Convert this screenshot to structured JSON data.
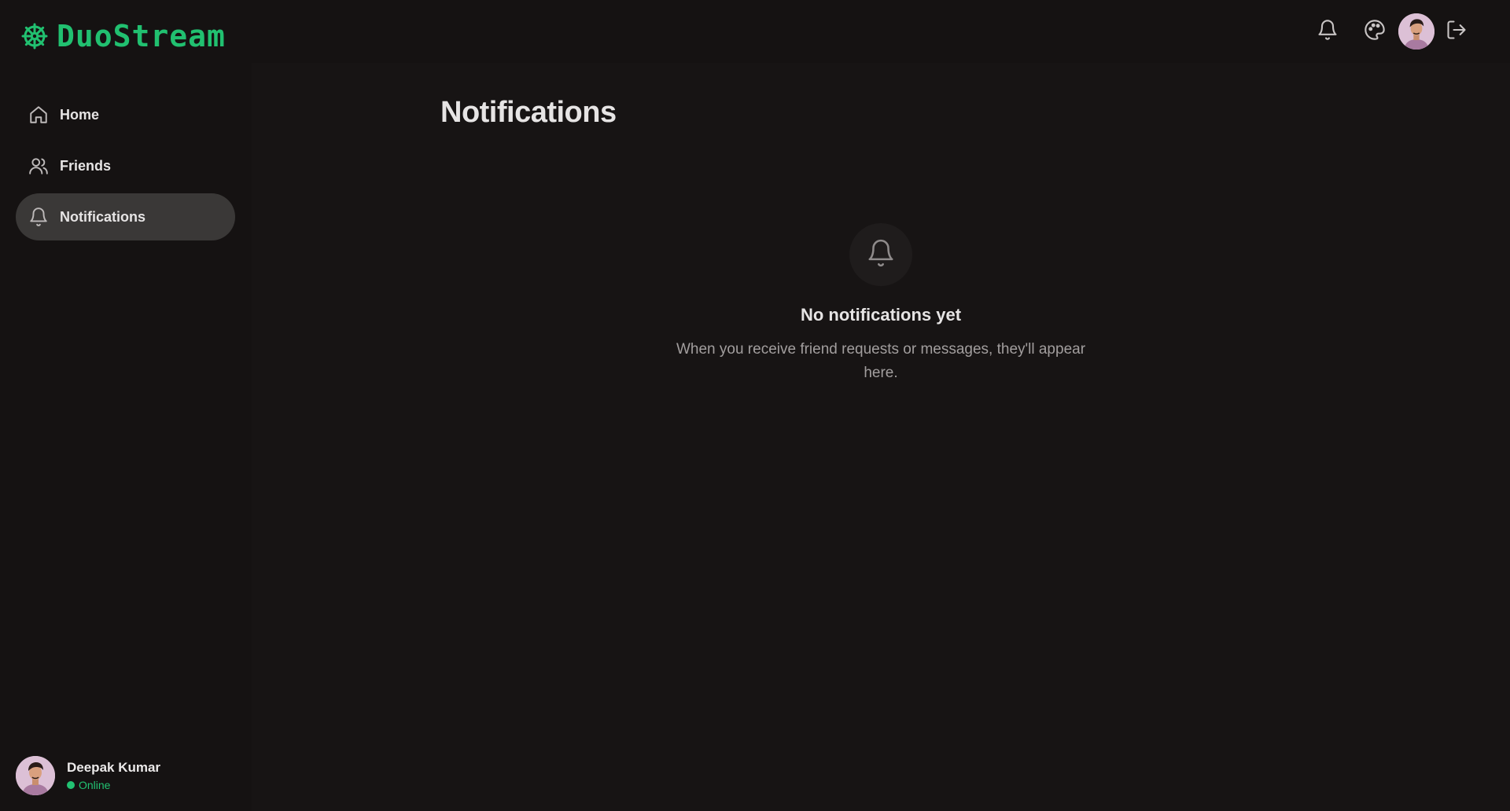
{
  "brand": {
    "name": "DuoStream",
    "icon": "ship-wheel-icon",
    "color": "#21c070"
  },
  "sidebar": {
    "items": [
      {
        "label": "Home",
        "icon": "home-icon",
        "active": false
      },
      {
        "label": "Friends",
        "icon": "users-icon",
        "active": false
      },
      {
        "label": "Notifications",
        "icon": "bell-icon",
        "active": true
      }
    ],
    "user": {
      "name": "Deepak Kumar",
      "status": "Online",
      "status_color": "#22c272"
    }
  },
  "header": {
    "actions": [
      "bell-icon",
      "palette-icon",
      "avatar",
      "logout-icon"
    ]
  },
  "main": {
    "title": "Notifications",
    "empty_state": {
      "icon": "bell-icon",
      "title": "No notifications yet",
      "description": "When you receive friend requests or messages, they'll appear here."
    }
  },
  "colors": {
    "background": "#171414",
    "sidebar": "#151212",
    "active_item": "#3a3837",
    "accent": "#21c070"
  }
}
